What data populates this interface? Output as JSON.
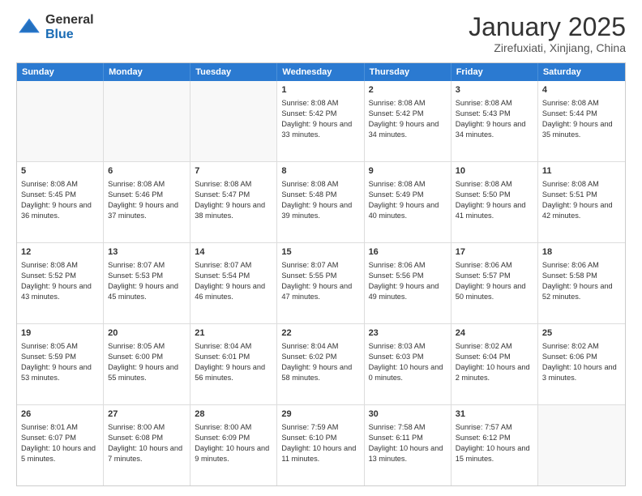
{
  "logo": {
    "general": "General",
    "blue": "Blue"
  },
  "header": {
    "month": "January 2025",
    "location": "Zirefuxiati, Xinjiang, China"
  },
  "weekdays": [
    "Sunday",
    "Monday",
    "Tuesday",
    "Wednesday",
    "Thursday",
    "Friday",
    "Saturday"
  ],
  "weeks": [
    [
      {
        "day": "",
        "empty": true
      },
      {
        "day": "",
        "empty": true
      },
      {
        "day": "",
        "empty": true
      },
      {
        "day": "1",
        "sunrise": "8:08 AM",
        "sunset": "5:42 PM",
        "daylight": "9 hours and 33 minutes."
      },
      {
        "day": "2",
        "sunrise": "8:08 AM",
        "sunset": "5:42 PM",
        "daylight": "9 hours and 34 minutes."
      },
      {
        "day": "3",
        "sunrise": "8:08 AM",
        "sunset": "5:43 PM",
        "daylight": "9 hours and 34 minutes."
      },
      {
        "day": "4",
        "sunrise": "8:08 AM",
        "sunset": "5:44 PM",
        "daylight": "9 hours and 35 minutes."
      }
    ],
    [
      {
        "day": "5",
        "sunrise": "8:08 AM",
        "sunset": "5:45 PM",
        "daylight": "9 hours and 36 minutes."
      },
      {
        "day": "6",
        "sunrise": "8:08 AM",
        "sunset": "5:46 PM",
        "daylight": "9 hours and 37 minutes."
      },
      {
        "day": "7",
        "sunrise": "8:08 AM",
        "sunset": "5:47 PM",
        "daylight": "9 hours and 38 minutes."
      },
      {
        "day": "8",
        "sunrise": "8:08 AM",
        "sunset": "5:48 PM",
        "daylight": "9 hours and 39 minutes."
      },
      {
        "day": "9",
        "sunrise": "8:08 AM",
        "sunset": "5:49 PM",
        "daylight": "9 hours and 40 minutes."
      },
      {
        "day": "10",
        "sunrise": "8:08 AM",
        "sunset": "5:50 PM",
        "daylight": "9 hours and 41 minutes."
      },
      {
        "day": "11",
        "sunrise": "8:08 AM",
        "sunset": "5:51 PM",
        "daylight": "9 hours and 42 minutes."
      }
    ],
    [
      {
        "day": "12",
        "sunrise": "8:08 AM",
        "sunset": "5:52 PM",
        "daylight": "9 hours and 43 minutes."
      },
      {
        "day": "13",
        "sunrise": "8:07 AM",
        "sunset": "5:53 PM",
        "daylight": "9 hours and 45 minutes."
      },
      {
        "day": "14",
        "sunrise": "8:07 AM",
        "sunset": "5:54 PM",
        "daylight": "9 hours and 46 minutes."
      },
      {
        "day": "15",
        "sunrise": "8:07 AM",
        "sunset": "5:55 PM",
        "daylight": "9 hours and 47 minutes."
      },
      {
        "day": "16",
        "sunrise": "8:06 AM",
        "sunset": "5:56 PM",
        "daylight": "9 hours and 49 minutes."
      },
      {
        "day": "17",
        "sunrise": "8:06 AM",
        "sunset": "5:57 PM",
        "daylight": "9 hours and 50 minutes."
      },
      {
        "day": "18",
        "sunrise": "8:06 AM",
        "sunset": "5:58 PM",
        "daylight": "9 hours and 52 minutes."
      }
    ],
    [
      {
        "day": "19",
        "sunrise": "8:05 AM",
        "sunset": "5:59 PM",
        "daylight": "9 hours and 53 minutes."
      },
      {
        "day": "20",
        "sunrise": "8:05 AM",
        "sunset": "6:00 PM",
        "daylight": "9 hours and 55 minutes."
      },
      {
        "day": "21",
        "sunrise": "8:04 AM",
        "sunset": "6:01 PM",
        "daylight": "9 hours and 56 minutes."
      },
      {
        "day": "22",
        "sunrise": "8:04 AM",
        "sunset": "6:02 PM",
        "daylight": "9 hours and 58 minutes."
      },
      {
        "day": "23",
        "sunrise": "8:03 AM",
        "sunset": "6:03 PM",
        "daylight": "10 hours and 0 minutes."
      },
      {
        "day": "24",
        "sunrise": "8:02 AM",
        "sunset": "6:04 PM",
        "daylight": "10 hours and 2 minutes."
      },
      {
        "day": "25",
        "sunrise": "8:02 AM",
        "sunset": "6:06 PM",
        "daylight": "10 hours and 3 minutes."
      }
    ],
    [
      {
        "day": "26",
        "sunrise": "8:01 AM",
        "sunset": "6:07 PM",
        "daylight": "10 hours and 5 minutes."
      },
      {
        "day": "27",
        "sunrise": "8:00 AM",
        "sunset": "6:08 PM",
        "daylight": "10 hours and 7 minutes."
      },
      {
        "day": "28",
        "sunrise": "8:00 AM",
        "sunset": "6:09 PM",
        "daylight": "10 hours and 9 minutes."
      },
      {
        "day": "29",
        "sunrise": "7:59 AM",
        "sunset": "6:10 PM",
        "daylight": "10 hours and 11 minutes."
      },
      {
        "day": "30",
        "sunrise": "7:58 AM",
        "sunset": "6:11 PM",
        "daylight": "10 hours and 13 minutes."
      },
      {
        "day": "31",
        "sunrise": "7:57 AM",
        "sunset": "6:12 PM",
        "daylight": "10 hours and 15 minutes."
      },
      {
        "day": "",
        "empty": true
      }
    ]
  ]
}
